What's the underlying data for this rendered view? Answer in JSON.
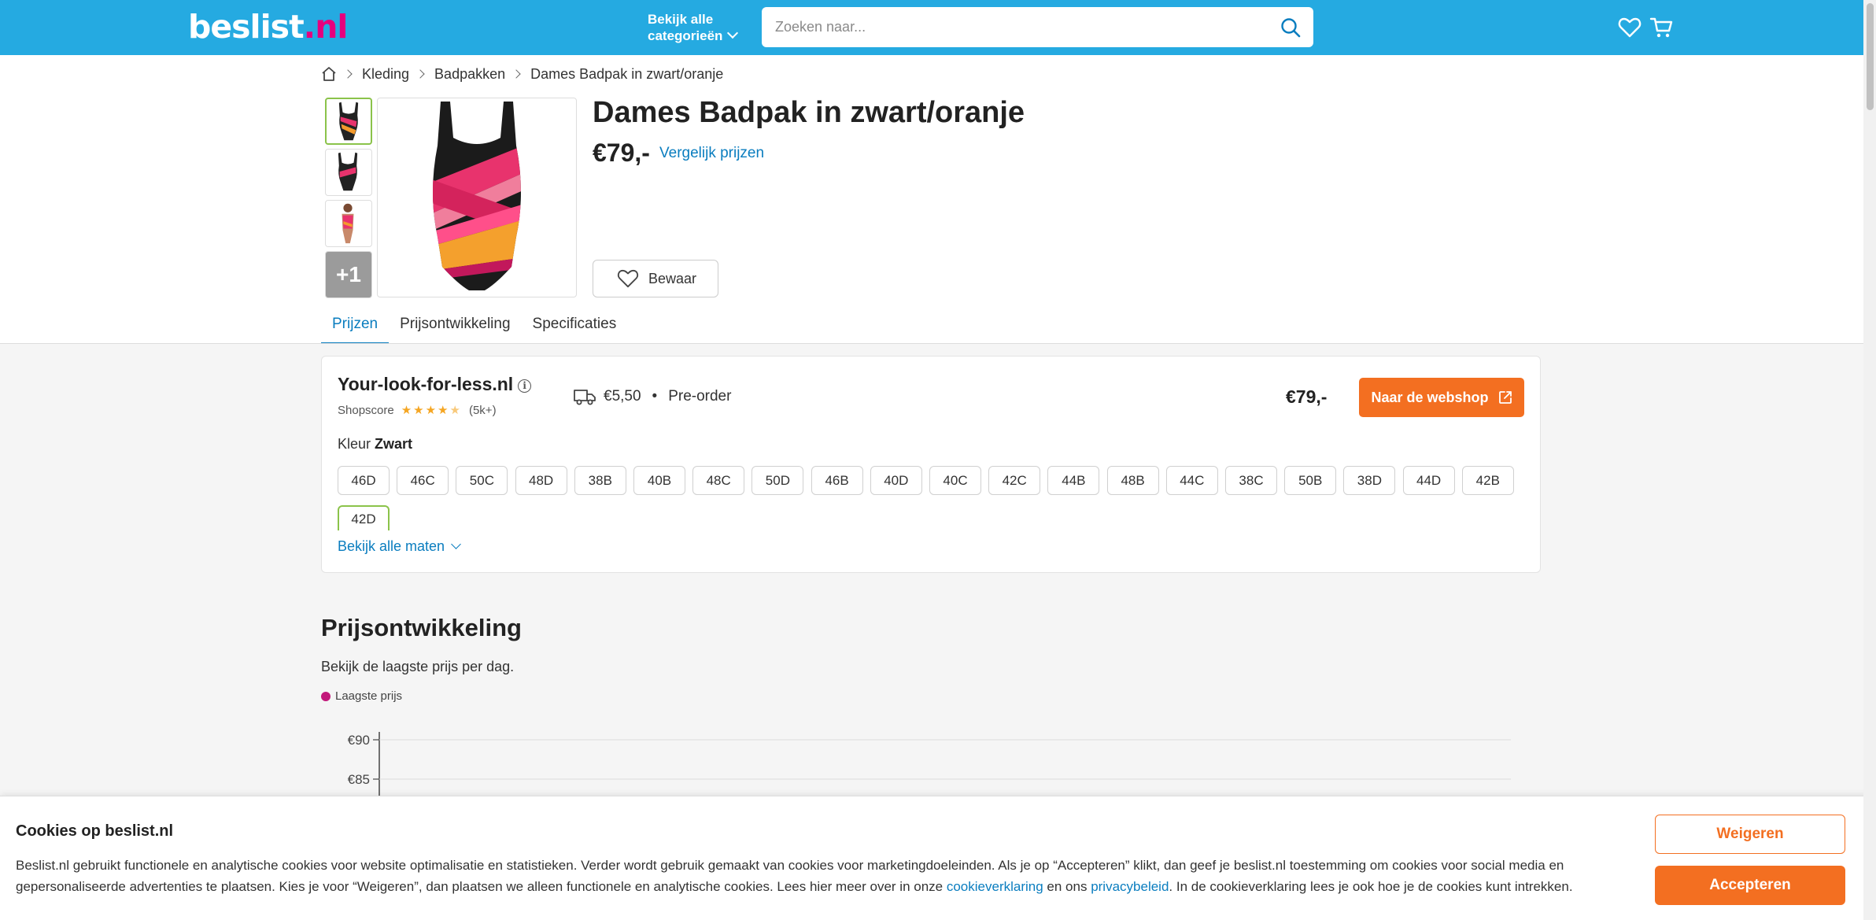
{
  "header": {
    "logo_main": "beslist",
    "logo_tld": ".nl",
    "categories_line1": "Bekijk alle",
    "categories_line2": "categorieën",
    "search_placeholder": "Zoeken naar...",
    "icons": [
      "search-icon",
      "heart-icon",
      "cart-icon"
    ],
    "brand_color": "#25aae1"
  },
  "breadcrumb": [
    "Kleding",
    "Badpakken",
    "Dames Badpak in zwart/oranje"
  ],
  "gallery": {
    "more_count": "+1"
  },
  "product": {
    "title": "Dames Badpak in zwart/oranje",
    "price": "€79,-",
    "compare_link": "Vergelijk prijzen",
    "save_label": "Bewaar"
  },
  "tabs": [
    "Prijzen",
    "Prijsontwikkeling",
    "Specificaties"
  ],
  "offer": {
    "shop_name": "Your-look-for-less.nl",
    "shopscore_label": "Shopscore",
    "rating": 4.5,
    "review_count": "(5k+)",
    "shipping": "€5,50",
    "dot": "•",
    "availability": "Pre-order",
    "price": "€79,-",
    "webshop_button": "Naar de webshop",
    "color_label": "Kleur",
    "color_value": "Zwart",
    "sizes": [
      "46D",
      "46C",
      "50C",
      "48D",
      "38B",
      "40B",
      "48C",
      "50D",
      "46B",
      "40D",
      "40C",
      "42C",
      "44B",
      "48B",
      "44C",
      "38C",
      "50B",
      "38D",
      "44D",
      "42B",
      "42D"
    ],
    "selected_size": "42D",
    "all_sizes_link": "Bekijk alle maten",
    "accent_color": "#f36f21"
  },
  "price_history": {
    "title": "Prijsontwikkeling",
    "subtitle": "Bekijk de laagste prijs per dag.",
    "legend_label": "Laagste prijs"
  },
  "chart_data": {
    "type": "line",
    "series": [
      {
        "name": "Laagste prijs",
        "values": []
      }
    ],
    "y_tick_labels": [
      "€90",
      "€85"
    ],
    "ylim_visible": [
      85,
      90
    ],
    "grid": true,
    "legend": "top-left",
    "series_color": "#c2187a"
  },
  "cookie": {
    "title": "Cookies op beslist.nl",
    "text_part1": "Beslist.nl gebruikt functionele en analytische cookies voor website optimalisatie en statistieken. Verder wordt gebruik gemaakt van cookies voor marketingdoeleinden. Als je op “Accepteren” klikt, dan geef je beslist.nl toestemming om cookies voor social media en gepersonaliseerde advertenties te plaatsen. Kies je voor “Weigeren”, dan plaatsen we alleen functionele en analytische cookies. Lees hier meer over in onze ",
    "link1": "cookieverklaring",
    "text_part2": " en ons ",
    "link2": "privacybeleid",
    "text_part3": ". In de cookieverklaring lees je ook hoe je de cookies kunt intrekken.",
    "reject_label": "Weigeren",
    "accept_label": "Accepteren"
  }
}
